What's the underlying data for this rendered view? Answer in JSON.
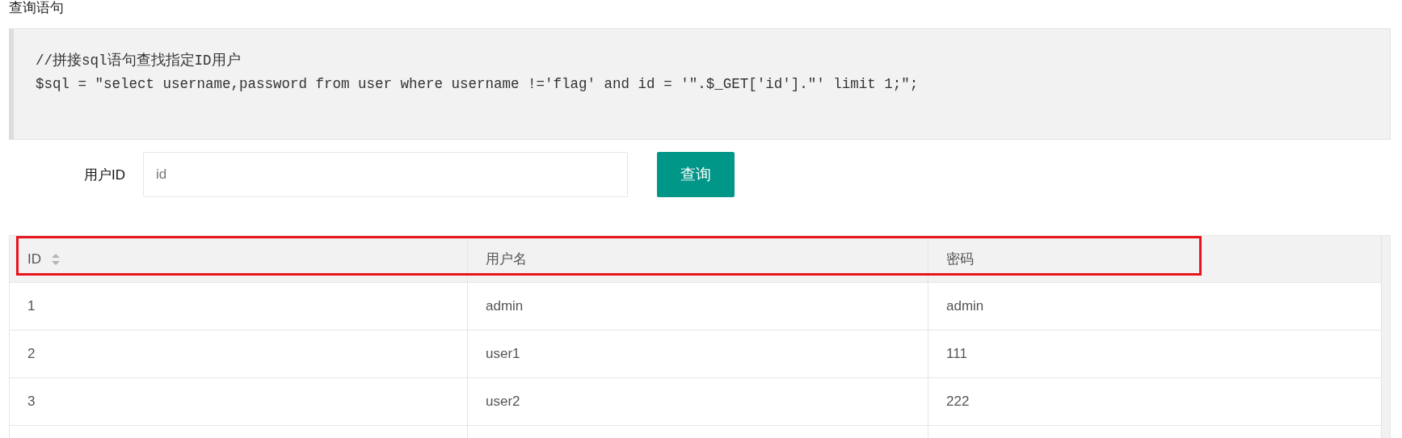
{
  "heading": "查询语句",
  "code": {
    "lines": [
      "//拼接sql语句查找指定ID用户",
      "$sql = \"select username,password from user where username !='flag' and id = '\".$_GET['id'].\"' limit 1;\";"
    ]
  },
  "form": {
    "label": "用户ID",
    "placeholder": "id",
    "button": "查询"
  },
  "table": {
    "columns": [
      {
        "label": "ID",
        "sortable": true
      },
      {
        "label": "用户名",
        "sortable": false
      },
      {
        "label": "密码",
        "sortable": false
      }
    ],
    "rows": [
      [
        "1",
        "admin",
        "admin"
      ],
      [
        "2",
        "user1",
        "111"
      ],
      [
        "3",
        "user2",
        "222"
      ]
    ],
    "highlight_header": true
  }
}
